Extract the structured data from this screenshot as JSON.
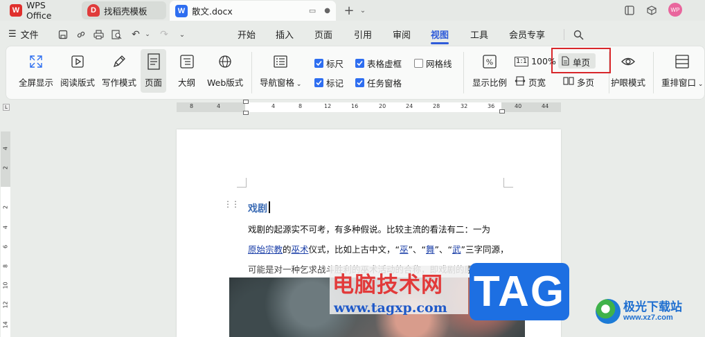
{
  "titlebar": {
    "tabs": [
      {
        "label": "WPS Office",
        "icon": "wps-logo-icon",
        "color": "#e0302d"
      },
      {
        "label": "找稻壳模板",
        "icon": "docer-icon",
        "color": "#e03b3b"
      },
      {
        "label": "散文.docx",
        "icon": "word-doc-icon",
        "color": "#2e6ef0"
      }
    ],
    "avatar_text": "WP"
  },
  "menubar": {
    "file_label": "文件",
    "tabs": [
      "开始",
      "插入",
      "页面",
      "引用",
      "审阅",
      "视图",
      "工具",
      "会员专享"
    ],
    "active_tab": "视图"
  },
  "ribbon": {
    "full_screen": "全屏显示",
    "read_mode": "阅读版式",
    "write_mode": "写作模式",
    "page": "页面",
    "outline": "大纲",
    "web_layout": "Web版式",
    "nav_pane": "导航窗格",
    "checkboxes": {
      "ruler": {
        "label": "标尺",
        "checked": true
      },
      "table_gridlines": {
        "label": "表格虚框",
        "checked": true
      },
      "gridlines": {
        "label": "网格线",
        "checked": false
      },
      "marks": {
        "label": "标记",
        "checked": true
      },
      "task_pane": {
        "label": "任务窗格",
        "checked": true
      }
    },
    "display_ratio": "显示比例",
    "zoom_100": "100%",
    "page_width": "页宽",
    "single_page": "单页",
    "multi_page": "多页",
    "eye_mode": "护眼模式",
    "rearrange_windows": "重排窗口"
  },
  "ruler": {
    "h_ticks": [
      "8",
      "4",
      "",
      "4",
      "8",
      "12",
      "16",
      "20",
      "24",
      "28",
      "32",
      "36",
      "40",
      "44"
    ],
    "v_ticks": [
      "4",
      "2",
      "",
      "2",
      "4",
      "6",
      "8",
      "10",
      "12",
      "14"
    ],
    "corner": "L"
  },
  "document": {
    "heading": "戏剧",
    "line1": "戏剧的起源实不可考，有多种假说。比较主流的看法有二：一为",
    "line2_link1": "原始宗教",
    "line2_mid1": "的",
    "line2_link2": "巫术",
    "line2_mid2": "仪式，比如上古中文，“",
    "line2_link3": "巫",
    "line2_mid3": "”、“",
    "line2_link4": "舞",
    "line2_mid4": "”、“",
    "line2_link5": "武",
    "line2_end": "”三字同源，",
    "line3": "可能是对一种乞求战斗胜利的巫术活动的合称，即戏剧的原始形"
  },
  "watermarks": {
    "site_cn": "电脑技术网",
    "site_url": "www.tagxp.com",
    "tag": "TAG",
    "logo_name": "极光下载站",
    "logo_url": "www.xz7.com"
  }
}
